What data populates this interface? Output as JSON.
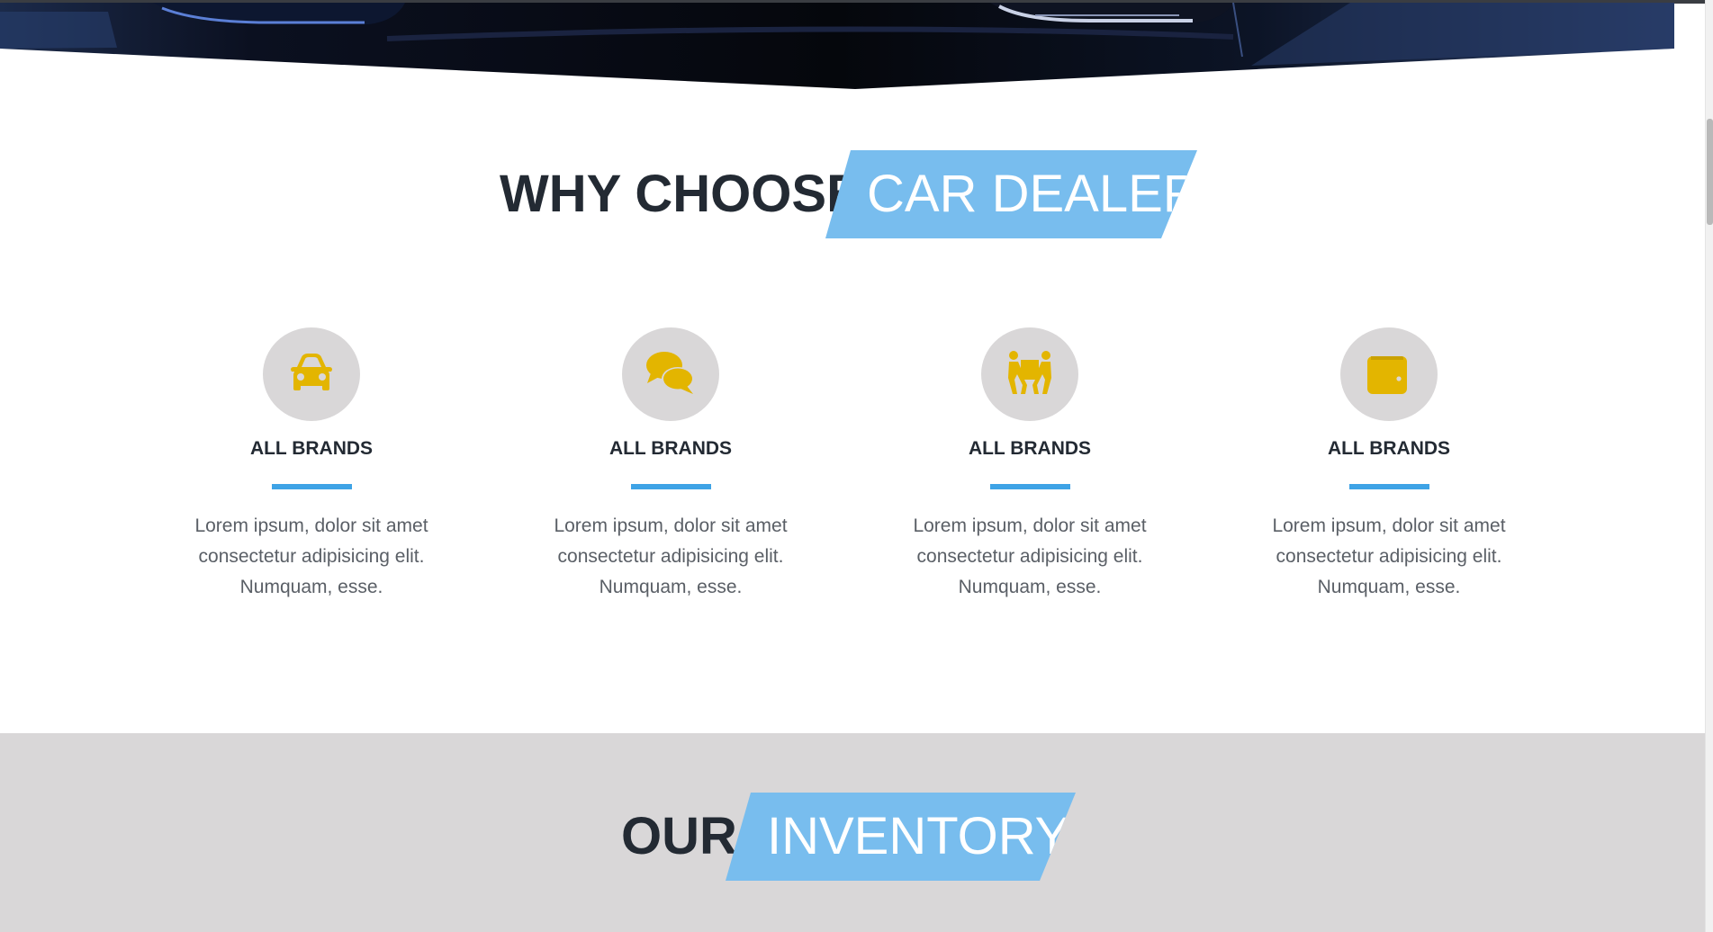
{
  "hero": {
    "description_icon": "car-front-photo"
  },
  "why_section": {
    "title_dark": "WHY CHOOSE",
    "title_highlight": "CAR DEALER",
    "features": [
      {
        "icon": "car-icon",
        "title": "ALL BRANDS",
        "text": "Lorem ipsum, dolor sit amet consectetur adipisicing elit. Numquam, esse."
      },
      {
        "icon": "chat-bubbles-icon",
        "title": "ALL BRANDS",
        "text": "Lorem ipsum, dolor sit amet consectetur adipisicing elit. Numquam, esse."
      },
      {
        "icon": "people-carry-icon",
        "title": "ALL BRANDS",
        "text": "Lorem ipsum, dolor sit amet consectetur adipisicing elit. Numquam, esse."
      },
      {
        "icon": "wallet-icon",
        "title": "ALL BRANDS",
        "text": "Lorem ipsum, dolor sit amet consectetur adipisicing elit. Numquam, esse."
      }
    ]
  },
  "inventory_section": {
    "title_dark": "OUR",
    "title_highlight": "INVENTORY"
  },
  "colors": {
    "accent_blue": "#78bdee",
    "divider_blue": "#3ea3e6",
    "icon_yellow": "#e3b500",
    "icon_circle": "#d9d7d8",
    "heading_dark": "#232a33",
    "inventory_bg": "#d9d7d8"
  }
}
